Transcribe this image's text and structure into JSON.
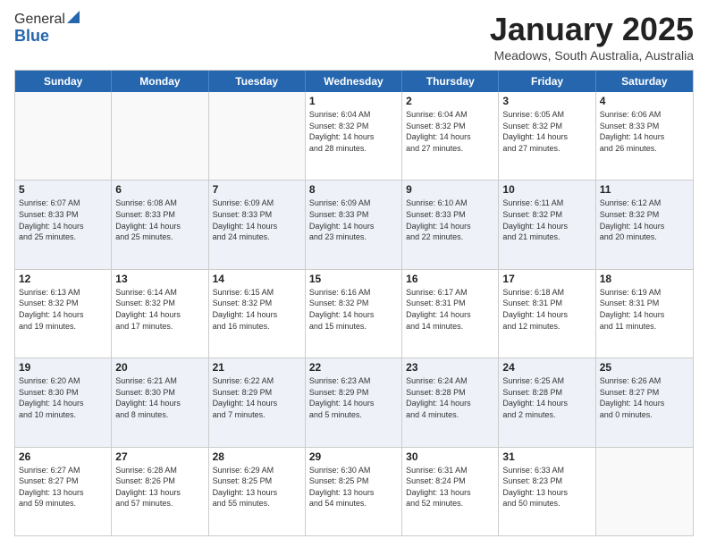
{
  "header": {
    "logo_general": "General",
    "logo_blue": "Blue",
    "month_title": "January 2025",
    "location": "Meadows, South Australia, Australia"
  },
  "day_headers": [
    "Sunday",
    "Monday",
    "Tuesday",
    "Wednesday",
    "Thursday",
    "Friday",
    "Saturday"
  ],
  "weeks": [
    {
      "days": [
        {
          "num": "",
          "info": "",
          "empty": true
        },
        {
          "num": "",
          "info": "",
          "empty": true
        },
        {
          "num": "",
          "info": "",
          "empty": true
        },
        {
          "num": "1",
          "info": "Sunrise: 6:04 AM\nSunset: 8:32 PM\nDaylight: 14 hours\nand 28 minutes.",
          "empty": false
        },
        {
          "num": "2",
          "info": "Sunrise: 6:04 AM\nSunset: 8:32 PM\nDaylight: 14 hours\nand 27 minutes.",
          "empty": false
        },
        {
          "num": "3",
          "info": "Sunrise: 6:05 AM\nSunset: 8:32 PM\nDaylight: 14 hours\nand 27 minutes.",
          "empty": false
        },
        {
          "num": "4",
          "info": "Sunrise: 6:06 AM\nSunset: 8:33 PM\nDaylight: 14 hours\nand 26 minutes.",
          "empty": false
        }
      ]
    },
    {
      "days": [
        {
          "num": "5",
          "info": "Sunrise: 6:07 AM\nSunset: 8:33 PM\nDaylight: 14 hours\nand 25 minutes.",
          "empty": false
        },
        {
          "num": "6",
          "info": "Sunrise: 6:08 AM\nSunset: 8:33 PM\nDaylight: 14 hours\nand 25 minutes.",
          "empty": false
        },
        {
          "num": "7",
          "info": "Sunrise: 6:09 AM\nSunset: 8:33 PM\nDaylight: 14 hours\nand 24 minutes.",
          "empty": false
        },
        {
          "num": "8",
          "info": "Sunrise: 6:09 AM\nSunset: 8:33 PM\nDaylight: 14 hours\nand 23 minutes.",
          "empty": false
        },
        {
          "num": "9",
          "info": "Sunrise: 6:10 AM\nSunset: 8:33 PM\nDaylight: 14 hours\nand 22 minutes.",
          "empty": false
        },
        {
          "num": "10",
          "info": "Sunrise: 6:11 AM\nSunset: 8:32 PM\nDaylight: 14 hours\nand 21 minutes.",
          "empty": false
        },
        {
          "num": "11",
          "info": "Sunrise: 6:12 AM\nSunset: 8:32 PM\nDaylight: 14 hours\nand 20 minutes.",
          "empty": false
        }
      ]
    },
    {
      "days": [
        {
          "num": "12",
          "info": "Sunrise: 6:13 AM\nSunset: 8:32 PM\nDaylight: 14 hours\nand 19 minutes.",
          "empty": false
        },
        {
          "num": "13",
          "info": "Sunrise: 6:14 AM\nSunset: 8:32 PM\nDaylight: 14 hours\nand 17 minutes.",
          "empty": false
        },
        {
          "num": "14",
          "info": "Sunrise: 6:15 AM\nSunset: 8:32 PM\nDaylight: 14 hours\nand 16 minutes.",
          "empty": false
        },
        {
          "num": "15",
          "info": "Sunrise: 6:16 AM\nSunset: 8:32 PM\nDaylight: 14 hours\nand 15 minutes.",
          "empty": false
        },
        {
          "num": "16",
          "info": "Sunrise: 6:17 AM\nSunset: 8:31 PM\nDaylight: 14 hours\nand 14 minutes.",
          "empty": false
        },
        {
          "num": "17",
          "info": "Sunrise: 6:18 AM\nSunset: 8:31 PM\nDaylight: 14 hours\nand 12 minutes.",
          "empty": false
        },
        {
          "num": "18",
          "info": "Sunrise: 6:19 AM\nSunset: 8:31 PM\nDaylight: 14 hours\nand 11 minutes.",
          "empty": false
        }
      ]
    },
    {
      "days": [
        {
          "num": "19",
          "info": "Sunrise: 6:20 AM\nSunset: 8:30 PM\nDaylight: 14 hours\nand 10 minutes.",
          "empty": false
        },
        {
          "num": "20",
          "info": "Sunrise: 6:21 AM\nSunset: 8:30 PM\nDaylight: 14 hours\nand 8 minutes.",
          "empty": false
        },
        {
          "num": "21",
          "info": "Sunrise: 6:22 AM\nSunset: 8:29 PM\nDaylight: 14 hours\nand 7 minutes.",
          "empty": false
        },
        {
          "num": "22",
          "info": "Sunrise: 6:23 AM\nSunset: 8:29 PM\nDaylight: 14 hours\nand 5 minutes.",
          "empty": false
        },
        {
          "num": "23",
          "info": "Sunrise: 6:24 AM\nSunset: 8:28 PM\nDaylight: 14 hours\nand 4 minutes.",
          "empty": false
        },
        {
          "num": "24",
          "info": "Sunrise: 6:25 AM\nSunset: 8:28 PM\nDaylight: 14 hours\nand 2 minutes.",
          "empty": false
        },
        {
          "num": "25",
          "info": "Sunrise: 6:26 AM\nSunset: 8:27 PM\nDaylight: 14 hours\nand 0 minutes.",
          "empty": false
        }
      ]
    },
    {
      "days": [
        {
          "num": "26",
          "info": "Sunrise: 6:27 AM\nSunset: 8:27 PM\nDaylight: 13 hours\nand 59 minutes.",
          "empty": false
        },
        {
          "num": "27",
          "info": "Sunrise: 6:28 AM\nSunset: 8:26 PM\nDaylight: 13 hours\nand 57 minutes.",
          "empty": false
        },
        {
          "num": "28",
          "info": "Sunrise: 6:29 AM\nSunset: 8:25 PM\nDaylight: 13 hours\nand 55 minutes.",
          "empty": false
        },
        {
          "num": "29",
          "info": "Sunrise: 6:30 AM\nSunset: 8:25 PM\nDaylight: 13 hours\nand 54 minutes.",
          "empty": false
        },
        {
          "num": "30",
          "info": "Sunrise: 6:31 AM\nSunset: 8:24 PM\nDaylight: 13 hours\nand 52 minutes.",
          "empty": false
        },
        {
          "num": "31",
          "info": "Sunrise: 6:33 AM\nSunset: 8:23 PM\nDaylight: 13 hours\nand 50 minutes.",
          "empty": false
        },
        {
          "num": "",
          "info": "",
          "empty": true
        }
      ]
    }
  ]
}
